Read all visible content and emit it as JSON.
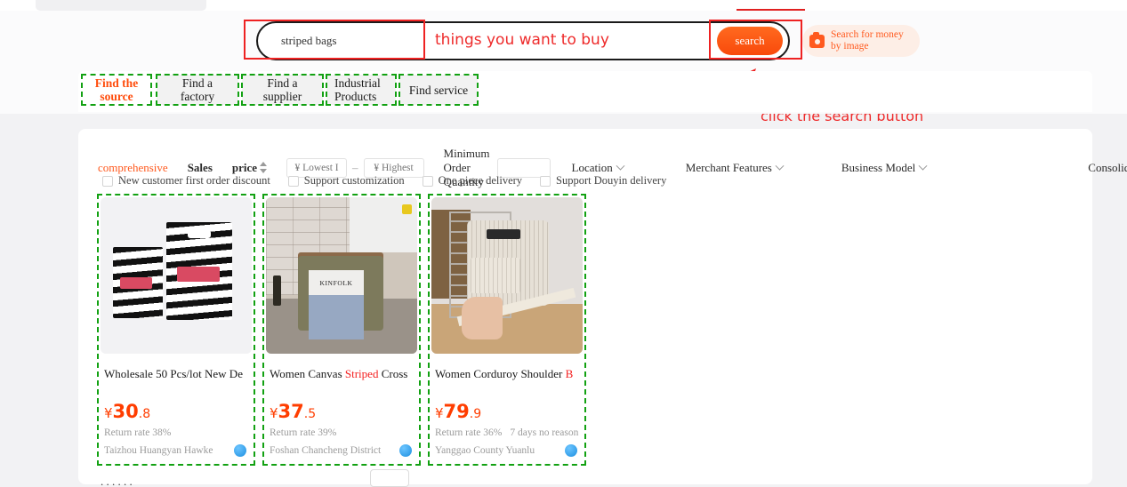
{
  "search": {
    "value": "striped bags",
    "placeholder": "striped bags",
    "button_label": "search",
    "image_search_line1": "Search for money",
    "image_search_line2": "by image",
    "camera_icon": "camera-icon"
  },
  "annotations": {
    "search_field_note": "things you want to buy",
    "search_button_note": "click the search button",
    "arrow_icon": "arrow-up-right-icon",
    "box_color": "#ee2222",
    "text_color": "#ee2a2a",
    "dash_color": "#12a112"
  },
  "tabs": [
    {
      "label": "Find the source",
      "active": true
    },
    {
      "label": "Find a factory",
      "active": false
    },
    {
      "label": "Find a supplier",
      "active": false
    },
    {
      "label": "Industrial Products",
      "active": false
    },
    {
      "label": "Find service",
      "active": false
    }
  ],
  "filters": {
    "sort": [
      {
        "label": "comprehensive",
        "active": true
      },
      {
        "label": "Sales",
        "active": false
      },
      {
        "label": "price",
        "active": false,
        "icon": "sort-arrows-icon"
      }
    ],
    "price_low_placeholder": "¥ Lowest I",
    "price_high_placeholder": "¥ Highest",
    "price_separator": "–",
    "moq_label": "Minimum Order Quantity",
    "moq_value": "",
    "dropdowns": [
      {
        "label": "Location"
      },
      {
        "label": "Merchant Features"
      },
      {
        "label": "Business Model"
      }
    ],
    "consolidation_label": "Consolidation of suppliers",
    "checkboxes": [
      {
        "label": "New customer first order discount",
        "checked": false
      },
      {
        "label": "Support customization",
        "checked": false
      },
      {
        "label": "One piece delivery",
        "checked": false
      },
      {
        "label": "Support Douyin delivery",
        "checked": false
      }
    ]
  },
  "products": [
    {
      "title_plain": "Wholesale 50 Pcs/lot New De",
      "title_pre": "Wholesale 50 Pcs/lot New De",
      "title_hl": "",
      "title_post": "",
      "currency": "¥",
      "price_int": "30",
      "price_dec": ".8",
      "return_rate": "Return rate 38%",
      "extra": "",
      "shop": "Taizhou Huangyan Hawke",
      "badge": "verified-badge-icon",
      "image_alt": "striped-plastic-bags-photo"
    },
    {
      "title_plain": "Women Canvas Striped Cross",
      "title_pre": "Women Canvas ",
      "title_hl": "Striped",
      "title_post": " Cross",
      "currency": "¥",
      "price_int": "37",
      "price_dec": ".5",
      "return_rate": "Return rate 39%",
      "extra": "",
      "shop": "Foshan Chancheng District",
      "badge": "verified-badge-icon",
      "image_alt": "canvas-crossbody-bag-photo"
    },
    {
      "title_plain": "Women Corduroy Shoulder B",
      "title_pre": "Women Corduroy Shoulder ",
      "title_hl": "B",
      "title_post": "",
      "currency": "¥",
      "price_int": "79",
      "price_dec": ".9",
      "return_rate": "Return rate 36%",
      "extra": "7 days no reason",
      "shop": "Yanggao County Yuanlu",
      "badge": "verified-badge-icon",
      "image_alt": "corduroy-shoulder-bag-photo"
    }
  ],
  "magazine_cover_text": "KINFOLK"
}
